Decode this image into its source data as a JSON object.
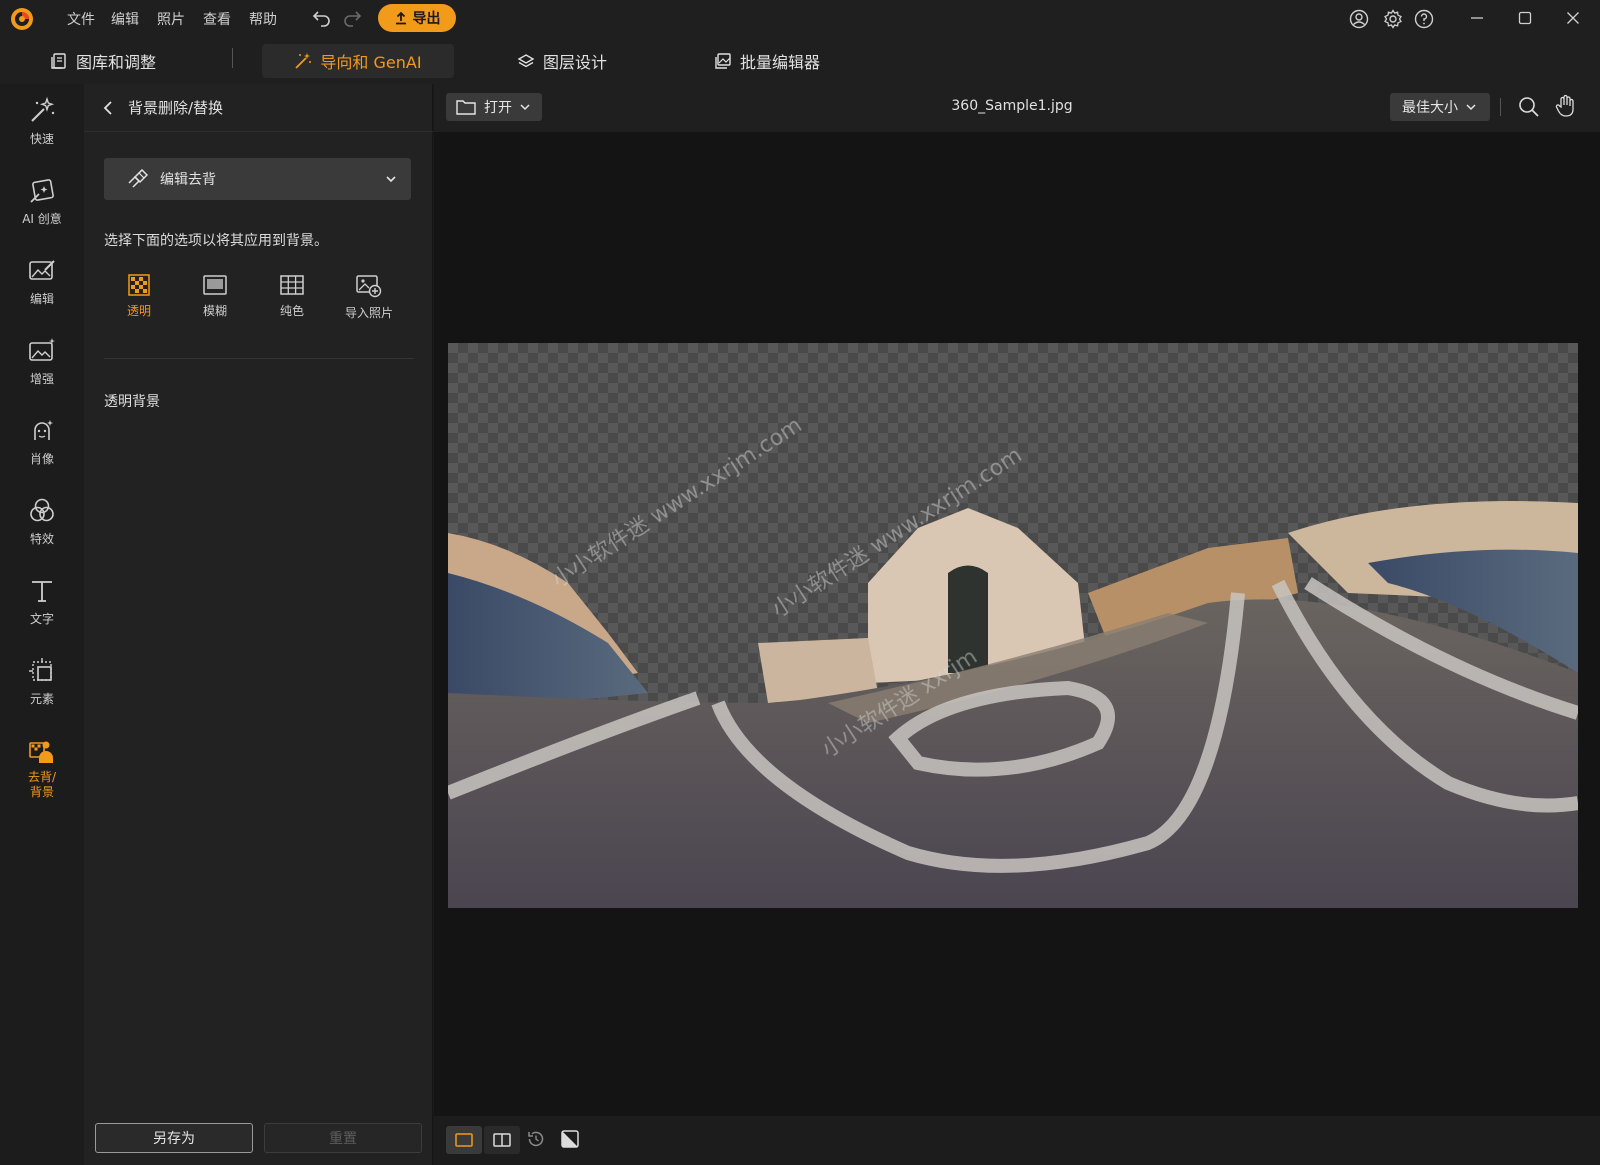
{
  "menu": {
    "file": "文件",
    "edit": "编辑",
    "photo": "照片",
    "view": "查看",
    "help": "帮助"
  },
  "export_label": "导出",
  "tabs": {
    "library": "图库和调整",
    "guided": "导向和 GenAI",
    "layers": "图层设计",
    "batch": "批量编辑器"
  },
  "rail": [
    {
      "label": "快速"
    },
    {
      "label": "AI 创意"
    },
    {
      "label": "编辑"
    },
    {
      "label": "增强"
    },
    {
      "label": "肖像"
    },
    {
      "label": "特效"
    },
    {
      "label": "文字"
    },
    {
      "label": "元素"
    },
    {
      "label": "去背/\n背景"
    }
  ],
  "panel": {
    "title": "背景删除/替换",
    "dropdown": "编辑去背",
    "hint": "选择下面的选项以将其应用到背景。",
    "options": [
      "透明",
      "模糊",
      "纯色",
      "导入照片"
    ],
    "section_title": "透明背景",
    "save_as": "另存为",
    "reset": "重置"
  },
  "canvas": {
    "open_label": "打开",
    "file_name": "360_Sample1.jpg",
    "zoom": "最佳大小"
  },
  "colors": {
    "accent": "#f29a1a",
    "bg": "#1a1a1a",
    "panel": "#222222"
  },
  "watermark": [
    "小小软件迷 www.xxrjm.com",
    "小小软件迷 www.xxrjm.com",
    "小小软件迷 xxrjm"
  ]
}
